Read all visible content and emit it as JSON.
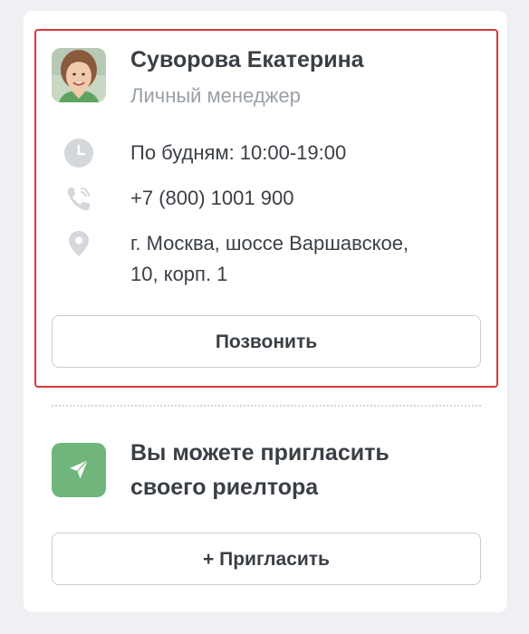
{
  "manager": {
    "name": "Суворова Екатерина",
    "role": "Личный менеджер",
    "hours": "По будням: 10:00-19:00",
    "phone": "+7 (800) 1001 900",
    "address_line1": "г. Москва, шоссе Варшавское,",
    "address_line2": "10, корп. 1",
    "call_button": "Позвонить"
  },
  "invite": {
    "line1": "Вы можете пригласить",
    "line2": "своего риелтора",
    "button": "+ Пригласить"
  },
  "icons": {
    "hours": "clock-icon",
    "phone": "phone-icon",
    "address": "location-pin-icon",
    "invite": "paper-plane-icon"
  },
  "colors": {
    "highlight_border": "#d9383a",
    "invite_icon_bg": "#6fb57c",
    "muted_text": "#9aa0a8",
    "icon_gray": "#d4d7db"
  }
}
